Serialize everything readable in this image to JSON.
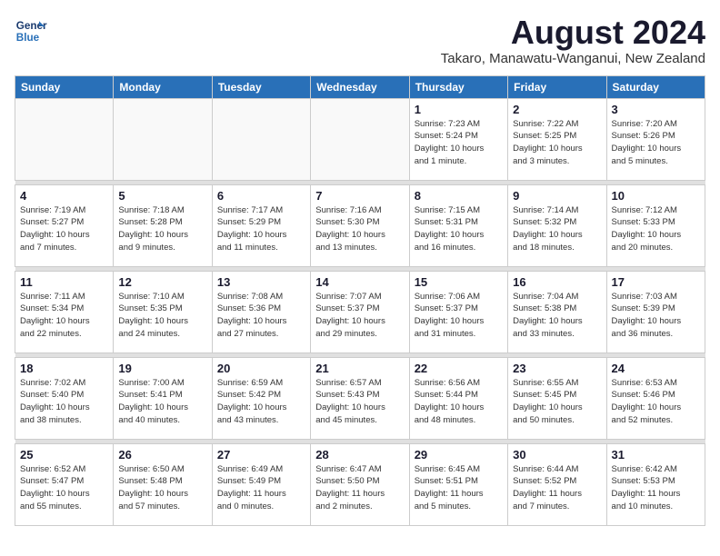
{
  "header": {
    "logo_line1": "General",
    "logo_line2": "Blue",
    "month_year": "August 2024",
    "location": "Takaro, Manawatu-Wanganui, New Zealand"
  },
  "days_of_week": [
    "Sunday",
    "Monday",
    "Tuesday",
    "Wednesday",
    "Thursday",
    "Friday",
    "Saturday"
  ],
  "weeks": [
    [
      {
        "day": "",
        "info": ""
      },
      {
        "day": "",
        "info": ""
      },
      {
        "day": "",
        "info": ""
      },
      {
        "day": "",
        "info": ""
      },
      {
        "day": "1",
        "info": "Sunrise: 7:23 AM\nSunset: 5:24 PM\nDaylight: 10 hours\nand 1 minute."
      },
      {
        "day": "2",
        "info": "Sunrise: 7:22 AM\nSunset: 5:25 PM\nDaylight: 10 hours\nand 3 minutes."
      },
      {
        "day": "3",
        "info": "Sunrise: 7:20 AM\nSunset: 5:26 PM\nDaylight: 10 hours\nand 5 minutes."
      }
    ],
    [
      {
        "day": "4",
        "info": "Sunrise: 7:19 AM\nSunset: 5:27 PM\nDaylight: 10 hours\nand 7 minutes."
      },
      {
        "day": "5",
        "info": "Sunrise: 7:18 AM\nSunset: 5:28 PM\nDaylight: 10 hours\nand 9 minutes."
      },
      {
        "day": "6",
        "info": "Sunrise: 7:17 AM\nSunset: 5:29 PM\nDaylight: 10 hours\nand 11 minutes."
      },
      {
        "day": "7",
        "info": "Sunrise: 7:16 AM\nSunset: 5:30 PM\nDaylight: 10 hours\nand 13 minutes."
      },
      {
        "day": "8",
        "info": "Sunrise: 7:15 AM\nSunset: 5:31 PM\nDaylight: 10 hours\nand 16 minutes."
      },
      {
        "day": "9",
        "info": "Sunrise: 7:14 AM\nSunset: 5:32 PM\nDaylight: 10 hours\nand 18 minutes."
      },
      {
        "day": "10",
        "info": "Sunrise: 7:12 AM\nSunset: 5:33 PM\nDaylight: 10 hours\nand 20 minutes."
      }
    ],
    [
      {
        "day": "11",
        "info": "Sunrise: 7:11 AM\nSunset: 5:34 PM\nDaylight: 10 hours\nand 22 minutes."
      },
      {
        "day": "12",
        "info": "Sunrise: 7:10 AM\nSunset: 5:35 PM\nDaylight: 10 hours\nand 24 minutes."
      },
      {
        "day": "13",
        "info": "Sunrise: 7:08 AM\nSunset: 5:36 PM\nDaylight: 10 hours\nand 27 minutes."
      },
      {
        "day": "14",
        "info": "Sunrise: 7:07 AM\nSunset: 5:37 PM\nDaylight: 10 hours\nand 29 minutes."
      },
      {
        "day": "15",
        "info": "Sunrise: 7:06 AM\nSunset: 5:37 PM\nDaylight: 10 hours\nand 31 minutes."
      },
      {
        "day": "16",
        "info": "Sunrise: 7:04 AM\nSunset: 5:38 PM\nDaylight: 10 hours\nand 33 minutes."
      },
      {
        "day": "17",
        "info": "Sunrise: 7:03 AM\nSunset: 5:39 PM\nDaylight: 10 hours\nand 36 minutes."
      }
    ],
    [
      {
        "day": "18",
        "info": "Sunrise: 7:02 AM\nSunset: 5:40 PM\nDaylight: 10 hours\nand 38 minutes."
      },
      {
        "day": "19",
        "info": "Sunrise: 7:00 AM\nSunset: 5:41 PM\nDaylight: 10 hours\nand 40 minutes."
      },
      {
        "day": "20",
        "info": "Sunrise: 6:59 AM\nSunset: 5:42 PM\nDaylight: 10 hours\nand 43 minutes."
      },
      {
        "day": "21",
        "info": "Sunrise: 6:57 AM\nSunset: 5:43 PM\nDaylight: 10 hours\nand 45 minutes."
      },
      {
        "day": "22",
        "info": "Sunrise: 6:56 AM\nSunset: 5:44 PM\nDaylight: 10 hours\nand 48 minutes."
      },
      {
        "day": "23",
        "info": "Sunrise: 6:55 AM\nSunset: 5:45 PM\nDaylight: 10 hours\nand 50 minutes."
      },
      {
        "day": "24",
        "info": "Sunrise: 6:53 AM\nSunset: 5:46 PM\nDaylight: 10 hours\nand 52 minutes."
      }
    ],
    [
      {
        "day": "25",
        "info": "Sunrise: 6:52 AM\nSunset: 5:47 PM\nDaylight: 10 hours\nand 55 minutes."
      },
      {
        "day": "26",
        "info": "Sunrise: 6:50 AM\nSunset: 5:48 PM\nDaylight: 10 hours\nand 57 minutes."
      },
      {
        "day": "27",
        "info": "Sunrise: 6:49 AM\nSunset: 5:49 PM\nDaylight: 11 hours\nand 0 minutes."
      },
      {
        "day": "28",
        "info": "Sunrise: 6:47 AM\nSunset: 5:50 PM\nDaylight: 11 hours\nand 2 minutes."
      },
      {
        "day": "29",
        "info": "Sunrise: 6:45 AM\nSunset: 5:51 PM\nDaylight: 11 hours\nand 5 minutes."
      },
      {
        "day": "30",
        "info": "Sunrise: 6:44 AM\nSunset: 5:52 PM\nDaylight: 11 hours\nand 7 minutes."
      },
      {
        "day": "31",
        "info": "Sunrise: 6:42 AM\nSunset: 5:53 PM\nDaylight: 11 hours\nand 10 minutes."
      }
    ]
  ]
}
